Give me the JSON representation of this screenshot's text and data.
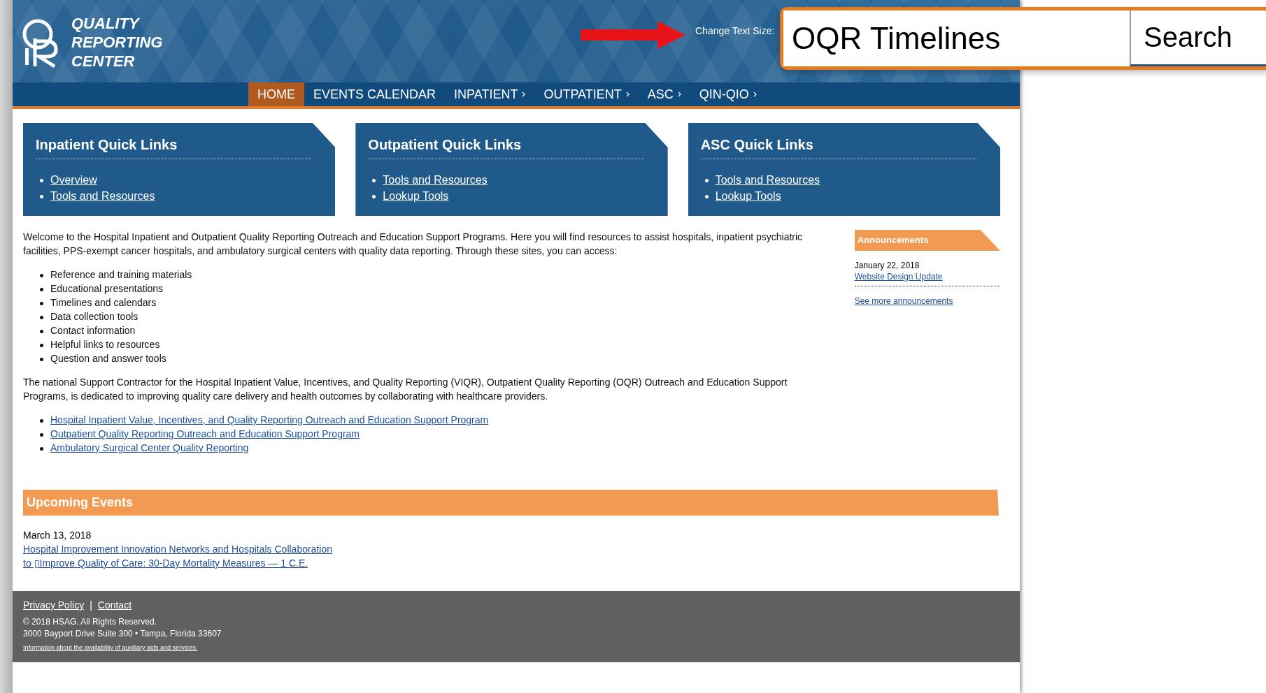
{
  "header": {
    "brand_lines": [
      "QUALITY",
      "REPORTING",
      "CENTER"
    ],
    "text_size_label": "Change Text Size:"
  },
  "search": {
    "value": "OQR Timelines",
    "button": "Search"
  },
  "nav": [
    {
      "label": "HOME",
      "selected": true,
      "submenu": false
    },
    {
      "label": "EVENTS CALENDAR",
      "selected": false,
      "submenu": false
    },
    {
      "label": "INPATIENT",
      "selected": false,
      "submenu": true
    },
    {
      "label": "OUTPATIENT",
      "selected": false,
      "submenu": true
    },
    {
      "label": "ASC",
      "selected": false,
      "submenu": true
    },
    {
      "label": "QIN-QIO",
      "selected": false,
      "submenu": true
    }
  ],
  "quick_links": [
    {
      "title": "Inpatient Quick Links",
      "links": [
        "Overview",
        "Tools and Resources"
      ]
    },
    {
      "title": "Outpatient Quick Links",
      "links": [
        "Tools and Resources",
        "Lookup Tools"
      ]
    },
    {
      "title": "ASC Quick Links",
      "links": [
        "Tools and Resources",
        "Lookup Tools"
      ]
    }
  ],
  "intro": "Welcome to the Hospital Inpatient and Outpatient Quality Reporting Outreach and Education Support Programs. Here you will find resources to assist hospitals, inpatient psychiatric facilities, PPS-exempt cancer hospitals, and ambulatory surgical centers with quality data reporting. Through these sites, you can access:",
  "access_list": [
    "Reference and training materials",
    "Educational presentations",
    "Timelines and calendars",
    "Data collection tools",
    "Contact information",
    "Helpful links to resources",
    "Question and answer tools"
  ],
  "contractor": "The national Support Contractor for the Hospital Inpatient Value, Incentives, and Quality Reporting (VIQR), Outpatient Quality Reporting (OQR) Outreach and Education Support Programs, is dedicated to improving quality care delivery and health outcomes by collaborating with healthcare providers.",
  "program_links": [
    "Hospital Inpatient Value, Incentives, and Quality Reporting Outreach and Education Support Program",
    "Outpatient Quality Reporting Outreach and Education Support Program",
    "Ambulatory Surgical Center Quality Reporting"
  ],
  "announcements": {
    "title": "Announcements",
    "items": [
      {
        "date": "January 22, 2018",
        "link": "Website Design Update"
      }
    ],
    "more": "See more announcements"
  },
  "events": {
    "title": "Upcoming Events",
    "items": [
      {
        "date": "March 13, 2018",
        "link_lines": [
          "Hospital Improvement Innovation Networks and Hospitals Collaboration",
          "to ▯Improve Quality of Care: 30-Day Mortality Measures — 1 C.E."
        ]
      }
    ]
  },
  "footer": {
    "links": [
      "Privacy Policy",
      "Contact"
    ],
    "separator": "|",
    "lines": [
      "© 2018 HSAG. All Rights Reserved.",
      "3000 Bayport Drive Suite 300 • Tampa, Florida 33607"
    ],
    "small_link": "Information about the availability of auxiliary aids and services."
  }
}
